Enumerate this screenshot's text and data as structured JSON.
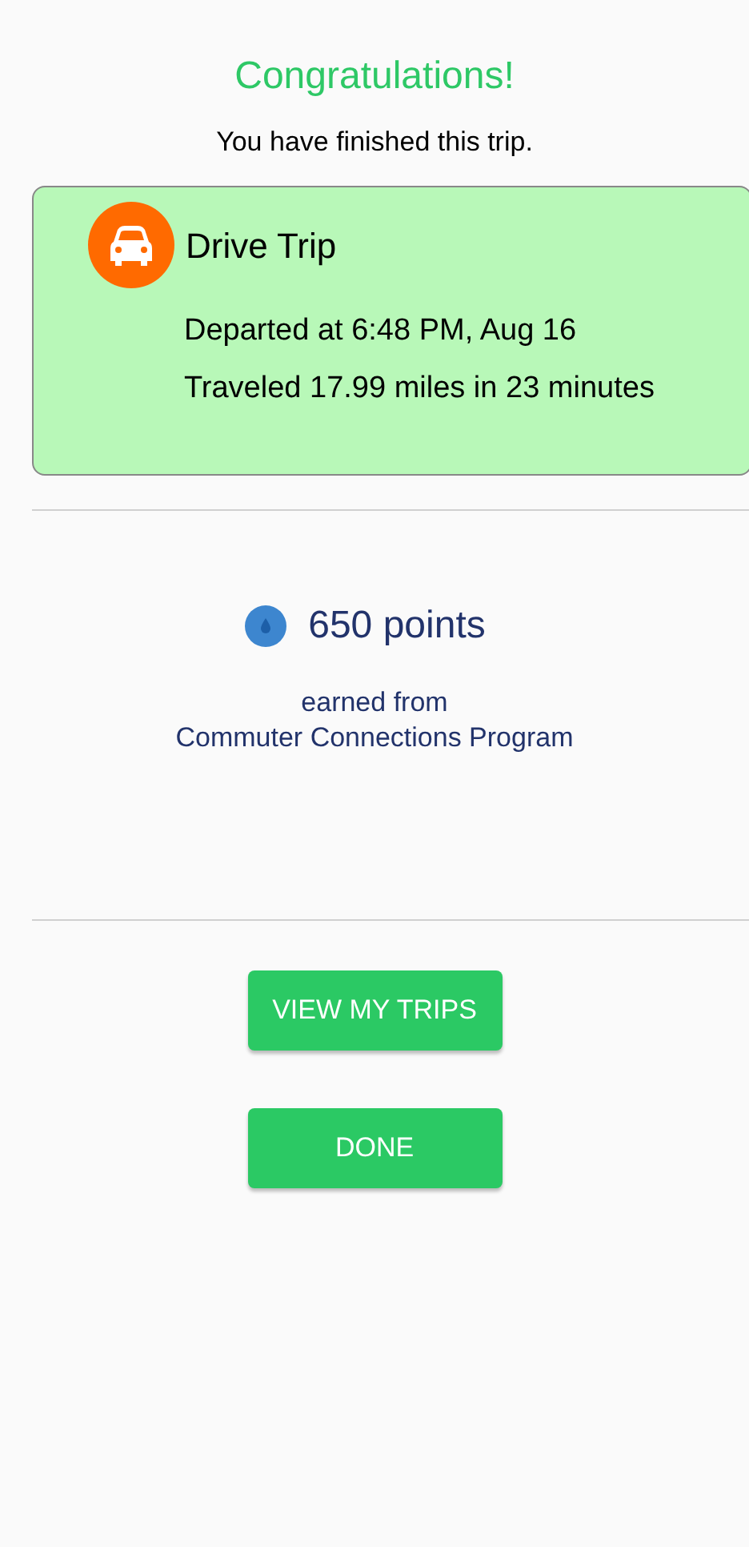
{
  "header": {
    "title": "Congratulations!",
    "subtitle": "You have finished this trip."
  },
  "trip": {
    "title": "Drive Trip",
    "details": [
      "Departed at 6:48 PM, Aug 16",
      "Traveled 17.99 miles in 23 minutes"
    ]
  },
  "reward": {
    "points": "650 points",
    "caption": "earned from",
    "program": "Commuter Connections Program"
  },
  "buttons": [
    "VIEW MY TRIPS",
    "DONE"
  ]
}
